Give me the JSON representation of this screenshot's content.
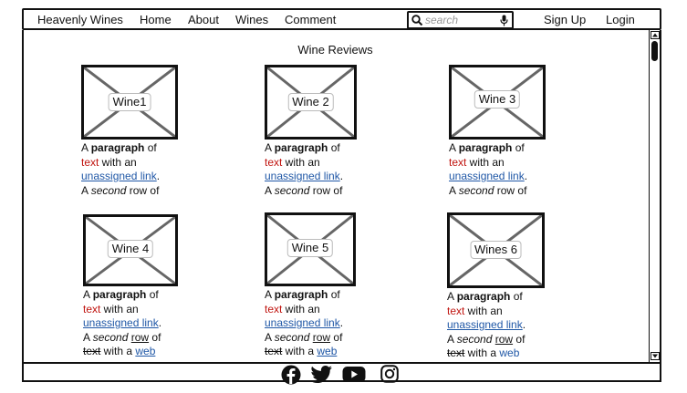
{
  "nav": {
    "brand": "Heavenly Wines",
    "links": [
      "Home",
      "About",
      "Wines",
      "Comment"
    ],
    "search_placeholder": "search",
    "signup": "Sign Up",
    "login": "Login"
  },
  "page_title": "Wine Reviews",
  "text": {
    "lead": "A ",
    "bold": "paragraph",
    "of": " of",
    "red": "text",
    "with_an": " with an",
    "link": "unassigned link",
    "period": ".",
    "a": "A ",
    "italic": "second",
    "row": " row of",
    "row_word": "row",
    "of2": " of",
    "text_word": "text",
    "with_a": " with a ",
    "web": "web"
  },
  "wines": [
    {
      "label": "Wine1"
    },
    {
      "label": "Wine 2"
    },
    {
      "label": "Wine 3"
    },
    {
      "label": "Wine 4"
    },
    {
      "label": "Wine 5"
    },
    {
      "label": "Wines 6"
    }
  ],
  "footer": {
    "icons": [
      "facebook-icon",
      "twitter-icon",
      "youtube-icon",
      "instagram-icon"
    ]
  },
  "colors": {
    "link": "#1f57a6",
    "red_text": "#c0140f",
    "border": "#111111"
  }
}
